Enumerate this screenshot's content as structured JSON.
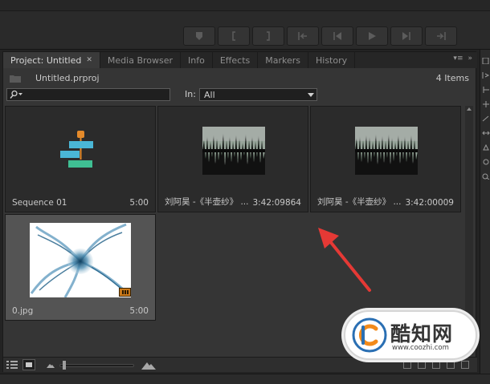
{
  "tabs": [
    {
      "label": "Project: Untitled",
      "active": true
    },
    {
      "label": "Media Browser",
      "active": false
    },
    {
      "label": "Info",
      "active": false
    },
    {
      "label": "Effects",
      "active": false
    },
    {
      "label": "Markers",
      "active": false
    },
    {
      "label": "History",
      "active": false
    }
  ],
  "project": {
    "filename": "Untitled.prproj",
    "item_count": "4 Items"
  },
  "search": {
    "value": "",
    "in_label": "In:",
    "in_selected": "All"
  },
  "items": [
    {
      "name": "Sequence 01",
      "duration": "5:00",
      "kind": "sequence"
    },
    {
      "name": "刘阿昊 -《半壶纱》 ...",
      "duration": "3:42:09864",
      "kind": "audio"
    },
    {
      "name": "刘阿昊 -《半壶纱》 ...",
      "duration": "3:42:00009",
      "kind": "audio"
    },
    {
      "name": "0.jpg",
      "duration": "5:00",
      "kind": "image",
      "selected": true
    }
  ],
  "transport_icons": [
    "marker-icon",
    "mark-in-icon",
    "mark-out-icon",
    "go-to-in-icon",
    "step-back-icon",
    "play-icon",
    "step-forward-icon",
    "go-to-out-icon"
  ],
  "bottom_toolbar": {
    "view_modes": [
      "list-view-icon",
      "icon-view-icon"
    ],
    "active_view": "icon-view-icon"
  },
  "watermark": {
    "brand": "酷知网",
    "url": "www.coozhi.com"
  },
  "colors": {
    "panel_bg": "#353535",
    "annotation_red": "#e53935",
    "badge_orange": "#cc7a1a"
  }
}
